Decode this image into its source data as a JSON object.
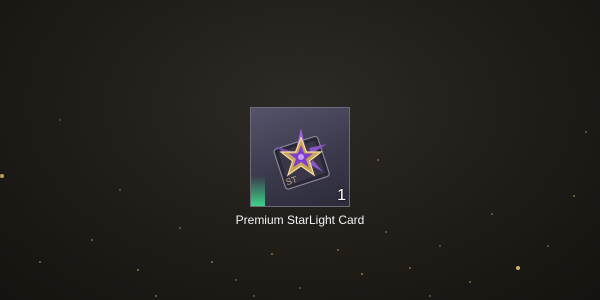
{
  "reward": {
    "item_name": "Premium StarLight Card",
    "quantity": "1",
    "rarity_color": "#3fd28a",
    "icon": "starlight-card-icon"
  }
}
